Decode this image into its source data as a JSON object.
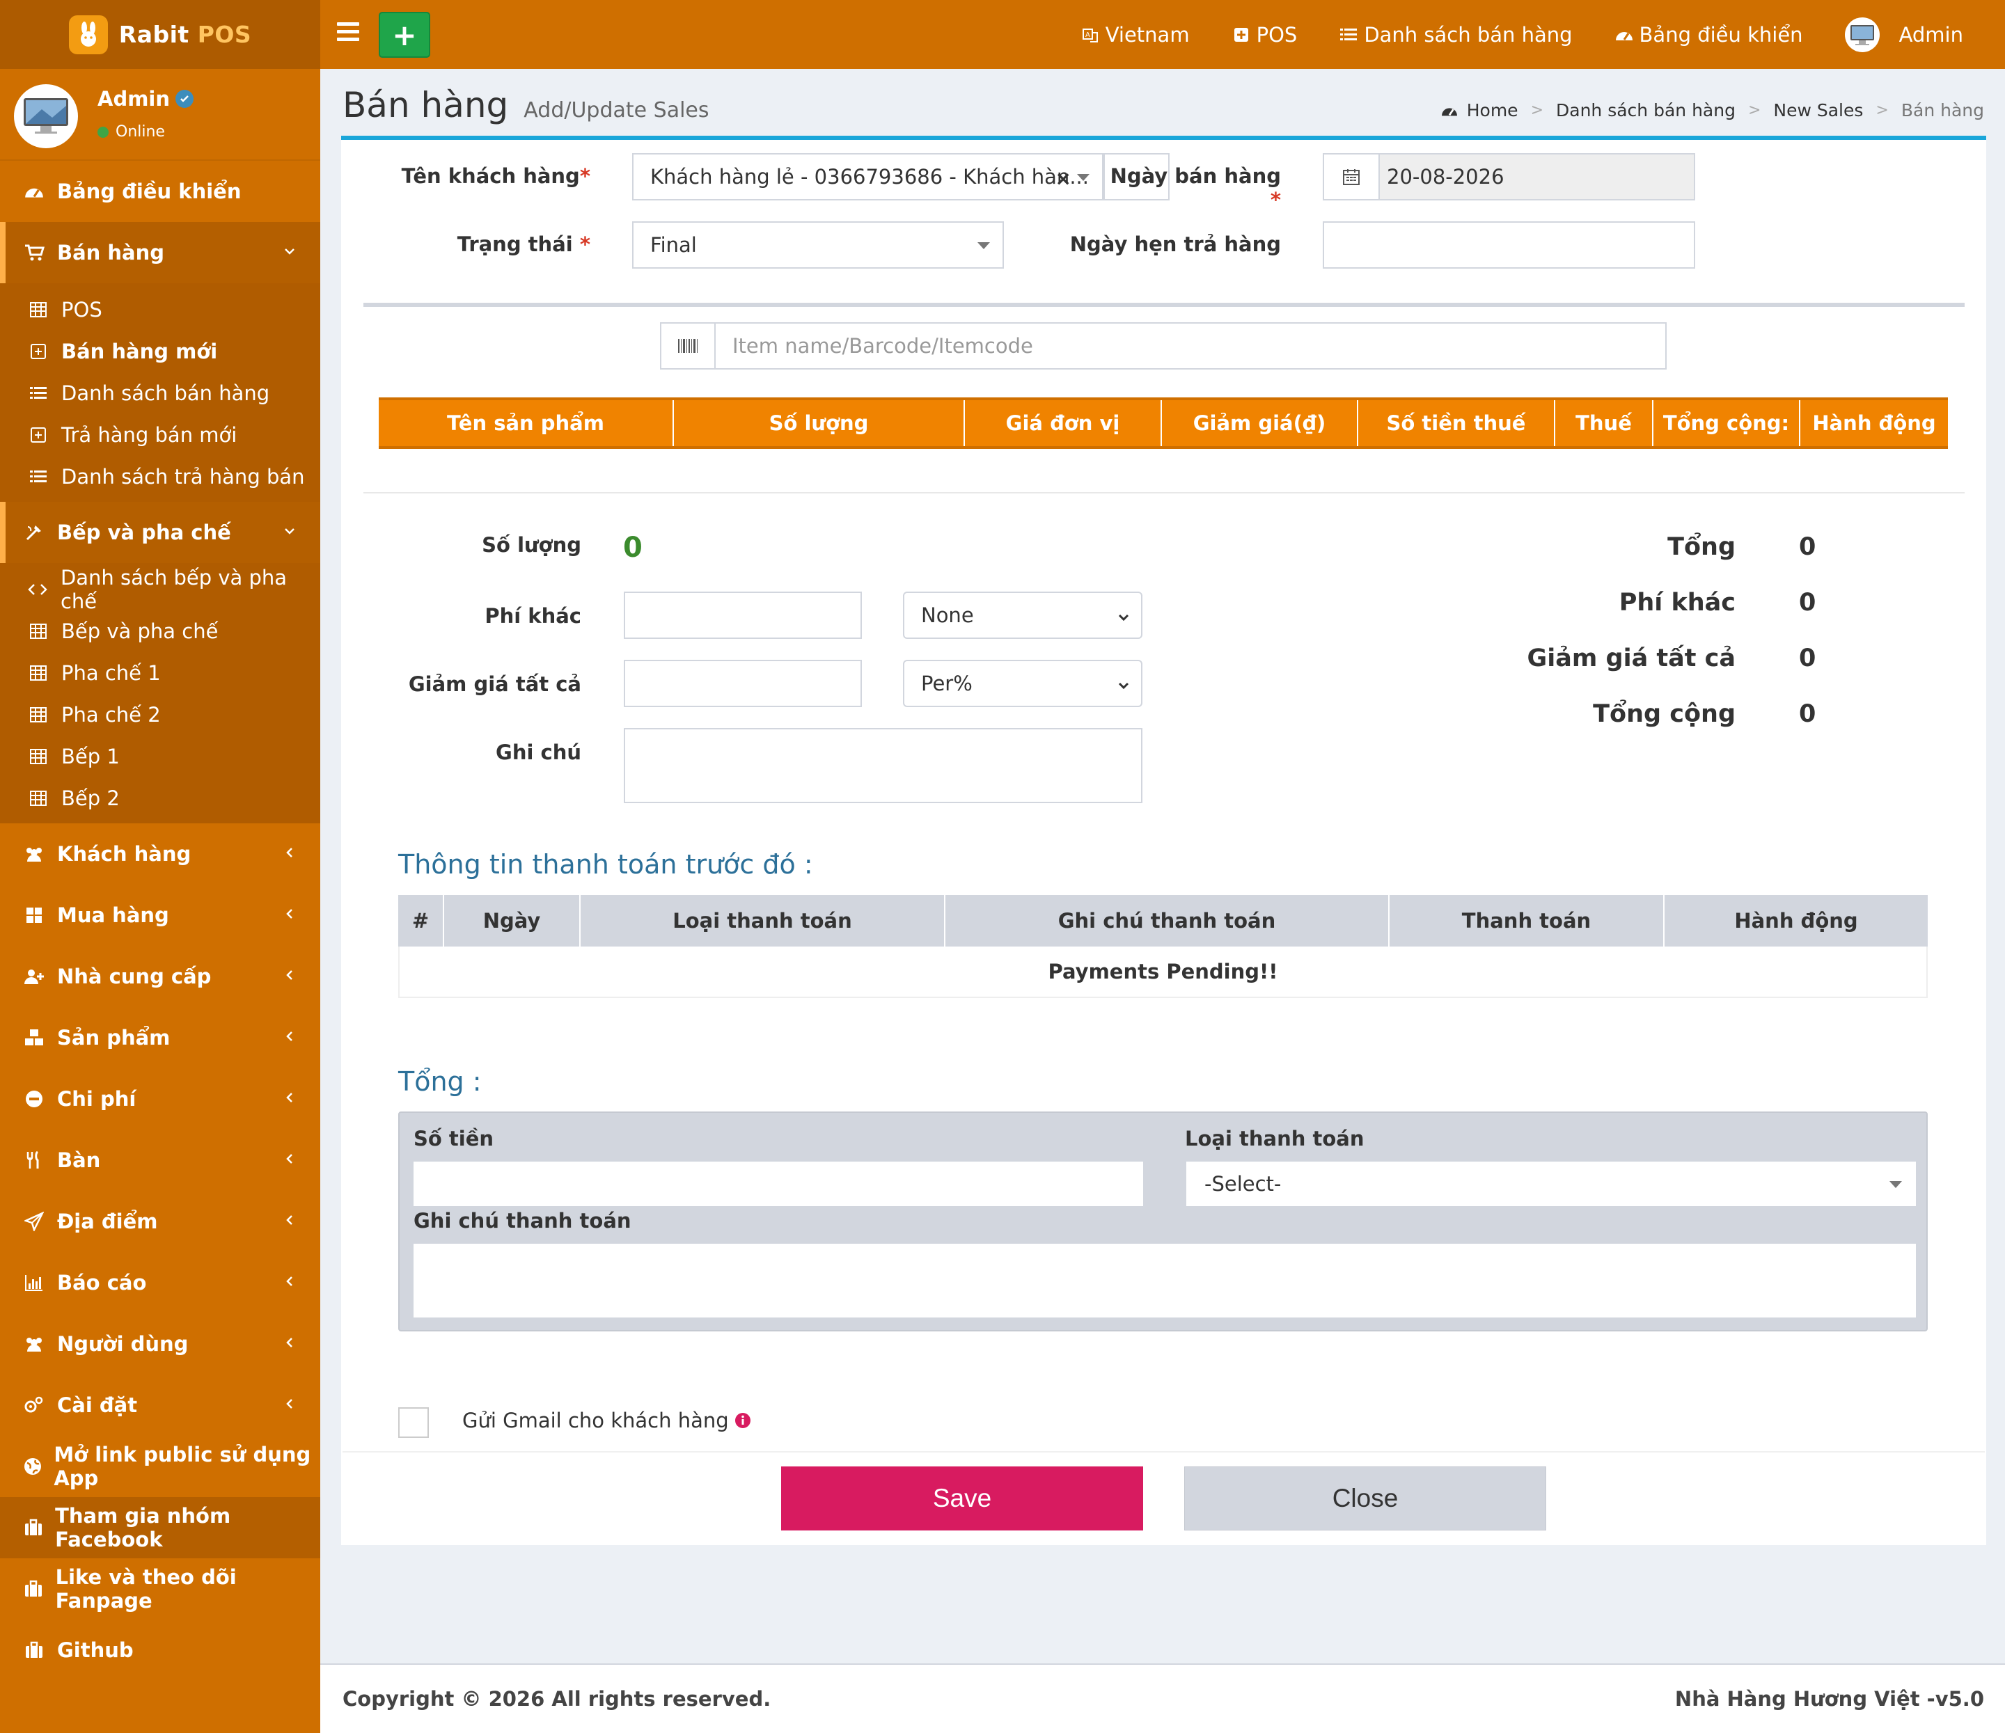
{
  "brand": {
    "name": "Rabit",
    "suffix": "POS"
  },
  "topnav": {
    "language": "Vietnam",
    "pos": "POS",
    "sales_list": "Danh sách bán hàng",
    "dashboard": "Bảng điều khiển",
    "user": "Admin"
  },
  "user_panel": {
    "name": "Admin",
    "status": "Online"
  },
  "sidebar": {
    "dashboard": "Bảng điều khiển",
    "sales": "Bán hàng",
    "sales_sub": [
      "POS",
      "Bán hàng mới",
      "Danh sách bán hàng",
      "Trả hàng bán mới",
      "Danh sách trả hàng bán"
    ],
    "kitchen": "Bếp và pha chế",
    "kitchen_sub": [
      "Danh sách bếp và pha chế",
      "Bếp và pha chế",
      "Pha chế 1",
      "Pha chế 2",
      "Bếp 1",
      "Bếp 2"
    ],
    "customers": "Khách hàng",
    "purchases": "Mua hàng",
    "suppliers": "Nhà cung cấp",
    "products": "Sản phẩm",
    "expenses": "Chi phí",
    "tables": "Bàn",
    "locations": "Địa điểm",
    "reports": "Báo cáo",
    "users": "Người dùng",
    "settings": "Cài đặt",
    "public_link": "Mở link public sử dụng App",
    "facebook_group": "Tham gia nhóm Facebook",
    "fanpage": "Like và theo dõi Fanpage",
    "github": "Github"
  },
  "page": {
    "title": "Bán hàng",
    "subtitle": "Add/Update Sales",
    "breadcrumb": [
      "Home",
      "Danh sách bán hàng",
      "New Sales",
      "Bán hàng"
    ]
  },
  "form": {
    "customer_label": "Tên khách hàng",
    "customer_value": "Khách hàng lẻ - 0366793686 - Khách hàn...",
    "sale_date_label": "Ngày bán hàng",
    "sale_date_value": "20-08-2026",
    "status_label": "Trạng thái",
    "status_value": "Final",
    "return_date_label": "Ngày hẹn trả hàng",
    "item_search_placeholder": "Item name/Barcode/Itemcode"
  },
  "items_table": {
    "columns": [
      "Tên sản phẩm",
      "Số lượng",
      "Giá đơn vị",
      "Giảm giá(₫)",
      "Số tiền thuế",
      "Thuế",
      "Tổng cộng:",
      "Hành động"
    ]
  },
  "summary": {
    "qty_label": "Số lượng",
    "qty_value": "0",
    "other_charges_label": "Phí khác",
    "other_charges_type": "None",
    "discount_all_label": "Giảm giá tất cả",
    "discount_type": "Per%",
    "note_label": "Ghi chú",
    "total_label": "Tổng",
    "total_value": "0",
    "other_label": "Phí khác",
    "other_value": "0",
    "discount_label": "Giảm giá tất cả",
    "discount_value": "0",
    "grand_label": "Tổng cộng",
    "grand_value": "0"
  },
  "previous_payments": {
    "title": "Thông tin thanh toán trước đó :",
    "columns": [
      "#",
      "Ngày",
      "Loại thanh toán",
      "Ghi chú thanh toán",
      "Thanh toán",
      "Hành động"
    ],
    "empty": "Payments Pending!!"
  },
  "totals": {
    "title": "Tổng :",
    "amount_label": "Số tiền",
    "payment_type_label": "Loại thanh toán",
    "payment_type_value": "-Select-",
    "payment_note_label": "Ghi chú thanh toán"
  },
  "email_option": "Gửi Gmail cho khách hàng",
  "buttons": {
    "save": "Save",
    "close": "Close"
  },
  "footer": {
    "copyright": "Copyright © 2026 All rights reserved.",
    "version": "Nhà Hàng Hương Việt -v5.0"
  },
  "colors": {
    "brand": "#cf6f00",
    "sidebar_dark": "#ad5b00",
    "table_head": "#f08300",
    "accent_blue": "#1aa6d9",
    "save": "#d81b60",
    "add": "#1fa54a"
  }
}
